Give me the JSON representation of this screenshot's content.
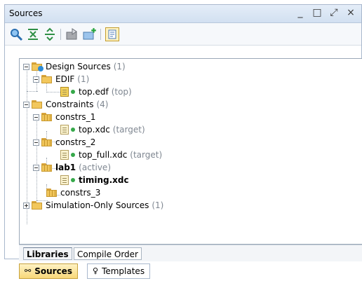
{
  "window": {
    "title": "Sources",
    "controls": [
      "minimize",
      "maximize",
      "float",
      "close"
    ]
  },
  "toolbar": {
    "icons": [
      "search-icon",
      "collapse-all-icon",
      "expand-all-icon",
      "import-icon",
      "add-sources-icon",
      "hierarchy-toggle-icon"
    ]
  },
  "tree": {
    "items": [
      {
        "label": "Design Sources",
        "count": "(1)",
        "icon": "design-sources-folder-icon"
      },
      {
        "label": "EDIF",
        "count": "(1)",
        "icon": "folder-icon"
      },
      {
        "label": "top.edf",
        "suffix": "(top)",
        "icon": "edif-file-icon"
      },
      {
        "label": "Constraints",
        "count": "(4)",
        "icon": "folder-icon"
      },
      {
        "label": "constrs_1",
        "icon": "constraint-set-icon"
      },
      {
        "label": "top.xdc",
        "suffix": "(target)",
        "icon": "xdc-file-icon"
      },
      {
        "label": "constrs_2",
        "icon": "constraint-set-icon"
      },
      {
        "label": "top_full.xdc",
        "suffix": "(target)",
        "icon": "xdc-file-icon"
      },
      {
        "label": "lab1",
        "suffix": "(active)",
        "icon": "constraint-set-icon"
      },
      {
        "label": "timing.xdc",
        "icon": "xdc-file-icon"
      },
      {
        "label": "constrs_3",
        "icon": "constraint-set-icon"
      },
      {
        "label": "Simulation-Only Sources",
        "count": "(1)",
        "icon": "folder-icon"
      }
    ]
  },
  "inner_tabs": [
    {
      "label": "Libraries",
      "active": true
    },
    {
      "label": "Compile Order",
      "active": false
    }
  ],
  "bottom_tabs": [
    {
      "label": "Sources",
      "active": true,
      "icon": "hierarchy-icon"
    },
    {
      "label": "Templates",
      "active": false,
      "icon": "lightbulb-icon"
    }
  ],
  "colors": {
    "titlebar_from": "#e4edf8",
    "titlebar_to": "#d2e0f1",
    "active_dot": "#36a84a",
    "muted_text": "#7f8791",
    "active_tab": "#f8d879"
  }
}
